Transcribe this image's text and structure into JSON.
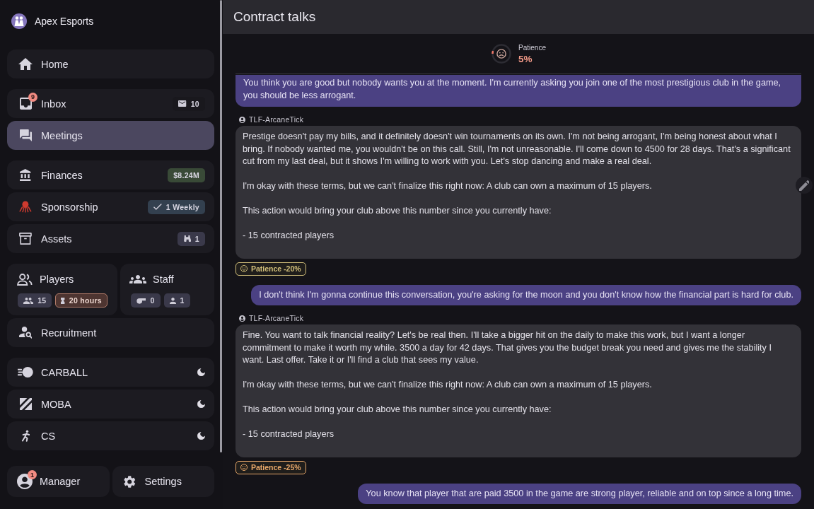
{
  "sidebar": {
    "club_name": "Apex Esports",
    "groups": [
      {
        "items": [
          {
            "kind": "nav",
            "label": "Home",
            "selected": false
          }
        ]
      },
      {
        "items": [
          {
            "kind": "nav",
            "label": "Inbox",
            "selected": false,
            "notification": "9",
            "badges": [
              {
                "text": "10",
                "color": "#19181d",
                "warning": false
              }
            ]
          },
          {
            "kind": "nav",
            "label": "Meetings",
            "selected": true
          }
        ]
      },
      {
        "items": [
          {
            "kind": "nav",
            "label": "Finances",
            "selected": false,
            "badges": [
              {
                "text": "$8.24M",
                "color": "#394a37",
                "warning": false
              }
            ]
          },
          {
            "kind": "nav",
            "label": "Sponsorship",
            "selected": false,
            "badges": [
              {
                "text": "1 Weekly",
                "color": "#33404f",
                "warning": false
              }
            ]
          },
          {
            "kind": "nav",
            "label": "Assets",
            "selected": false,
            "badges": [
              {
                "text": "1",
                "color": "#3a394a",
                "warning": false
              }
            ]
          }
        ]
      },
      {
        "items": [
          {
            "kind": "pair",
            "tiles": [
              {
                "label": "Players",
                "selected": false,
                "badges": [
                  {
                    "text": "15",
                    "color": "#3a394a",
                    "warning": false
                  },
                  {
                    "text": "20 hours",
                    "color": "#4e3531",
                    "warning": true
                  }
                ]
              },
              {
                "label": "Staff",
                "selected": false,
                "badges": [
                  {
                    "text": "0",
                    "color": "#3a394a",
                    "warning": false
                  },
                  {
                    "text": "1",
                    "color": "#3a394a",
                    "warning": false
                  }
                ]
              }
            ]
          },
          {
            "kind": "nav",
            "label": "Recruitment",
            "selected": false
          }
        ]
      },
      {
        "items": [
          {
            "kind": "game",
            "label": "CARBALL",
            "selected": false
          },
          {
            "kind": "game",
            "label": "MOBA",
            "selected": false
          },
          {
            "kind": "game",
            "label": "CS",
            "selected": false
          }
        ]
      },
      {
        "items": [
          {
            "kind": "pair",
            "tiles": [
              {
                "label": "Manager",
                "selected": false,
                "notification": "1"
              },
              {
                "label": "Settings",
                "selected": false
              }
            ]
          }
        ]
      }
    ]
  },
  "main": {
    "title": "Contract talks",
    "patience": {
      "label": "Patience",
      "value": "5%",
      "level": 0.05
    },
    "messages": [
      {
        "kind": "outgoing",
        "text": "You think you are good but nobody wants you at the moment. I'm currently asking you join one of the most prestigious club in the game, you should be less arrogant."
      },
      {
        "kind": "incoming",
        "sender": "TLF-ArcaneTick",
        "paragraphs": [
          "Prestige doesn't pay my bills, and it definitely doesn't win tournaments on its own. I'm not being arrogant, I'm being honest about what I bring. If nobody wanted me, you wouldn't be on this call. Still, I'm not unreasonable. I'll come down to 4500 for 28 days. That's a significant cut from my last deal, but it shows I'm willing to work with you. Let's stop dancing and make a real deal.",
          "I'm okay with these terms, but we can't finalize this right now: A club can own a maximum of 15 players.",
          "This action would bring your club above this number since you currently have:",
          "- 15 contracted players"
        ]
      },
      {
        "kind": "effect",
        "text": "Patience -20%",
        "color": "#d2bf7a"
      },
      {
        "kind": "outgoing",
        "text": "I don't think I'm gonna continue this conversation, you're asking for the moon and you don't know how the financial part is hard for club."
      },
      {
        "kind": "incoming",
        "sender": "TLF-ArcaneTick",
        "paragraphs": [
          "Fine. You want to talk financial reality? Let's be real then. I'll take a bigger hit on the daily to make this work, but I want a longer commitment to make it worth my while. 3500 a day for 42 days. That gives you the budget break you need and gives me the stability I want. Last offer. Take it or I'll find a club that sees my value.",
          "I'm okay with these terms, but we can't finalize this right now: A club can own a maximum of 15 players.",
          "This action would bring your club above this number since you currently have:",
          "- 15 contracted players"
        ]
      },
      {
        "kind": "effect",
        "text": "Patience -25%",
        "color": "#e8a86a"
      },
      {
        "kind": "outgoing",
        "text": "You know that player that are paid 3500 in the game are strong player, reliable and on top since a long time."
      }
    ]
  }
}
